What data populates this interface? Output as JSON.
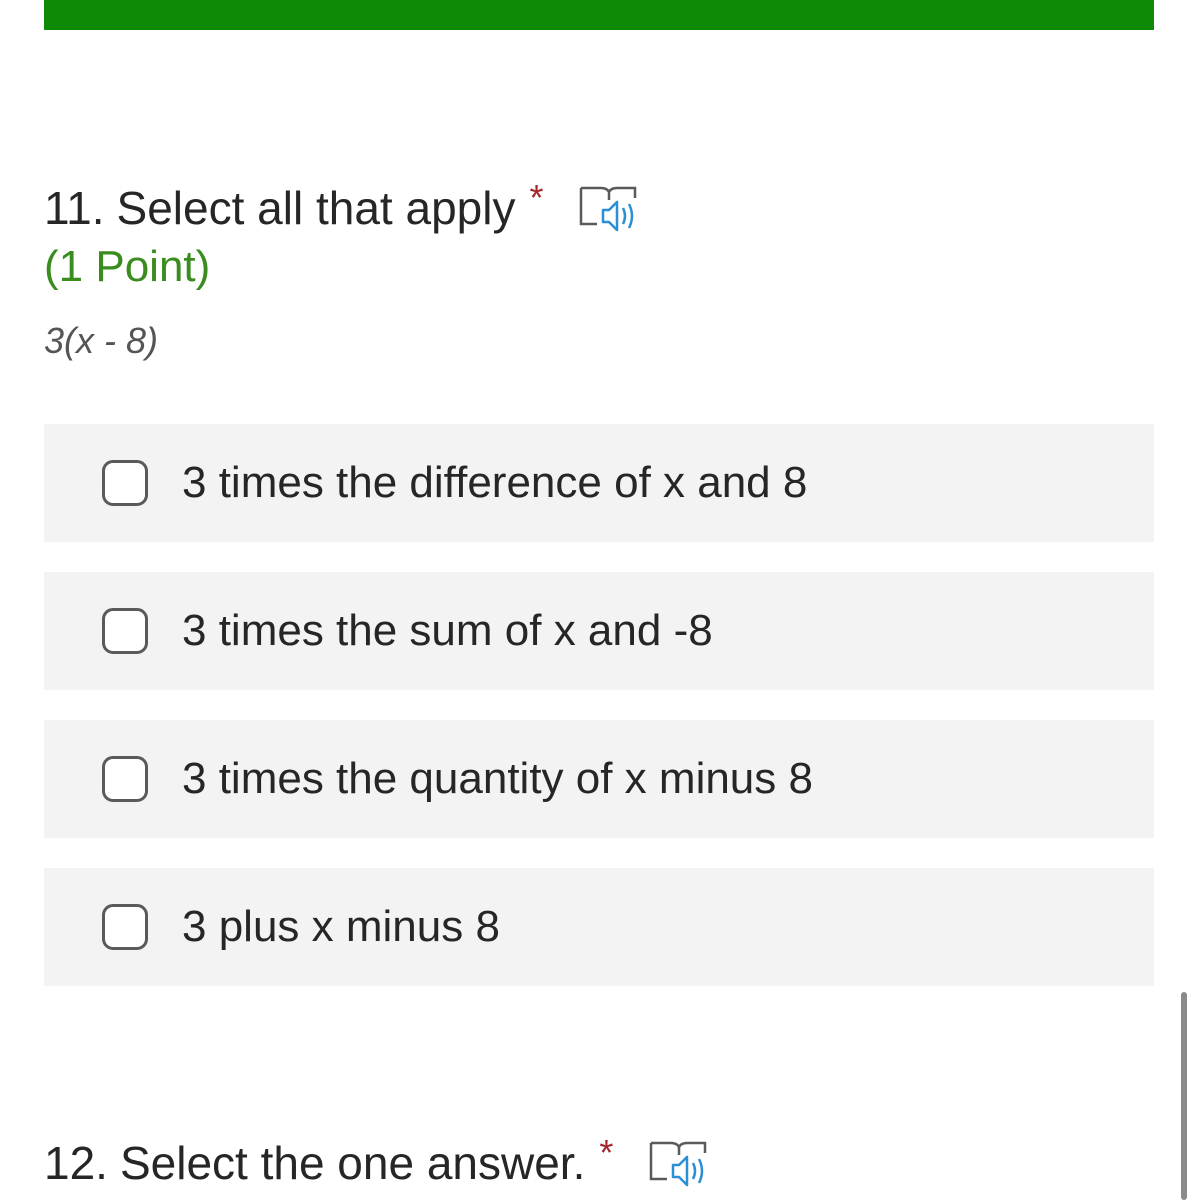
{
  "form": {
    "accent_color": "#0f8a06"
  },
  "question11": {
    "number": "11.",
    "title": "Select all that apply",
    "required_marker": "*",
    "points": "(1 Point)",
    "subtitle": "3(x - 8)",
    "options": [
      {
        "label": "3 times the difference of x and 8",
        "checked": false
      },
      {
        "label": "3 times the sum of x and -8",
        "checked": false
      },
      {
        "label": "3 times the quantity of x minus 8",
        "checked": false
      },
      {
        "label": "3 plus x minus 8",
        "checked": false
      }
    ],
    "reader_icon": "immersive-reader-icon"
  },
  "question12": {
    "number": "12.",
    "title": "Select the one answer.",
    "required_marker": "*",
    "reader_icon": "immersive-reader-icon"
  }
}
